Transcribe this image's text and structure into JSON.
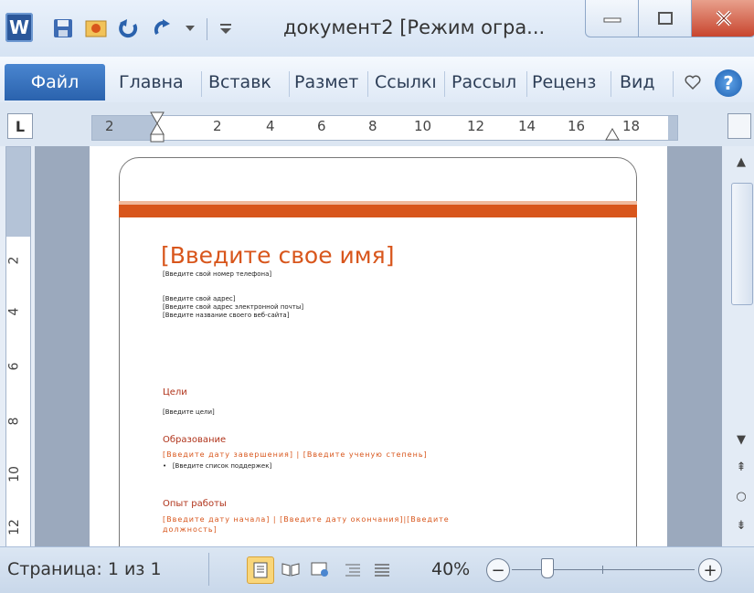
{
  "titlebar": {
    "app_icon_letter": "W",
    "title": "документ2 [Режим огра...",
    "quick_access": [
      "save-icon",
      "new-icon",
      "undo-icon",
      "redo-icon",
      "customize-icon"
    ]
  },
  "ribbon": {
    "file_tab": "Файл",
    "tabs": [
      "Главна",
      "Вставк",
      "Размет",
      "Ссылкı",
      "Рассыл",
      "Реценз",
      "Вид"
    ]
  },
  "ruler": {
    "tab_selector": "L",
    "h_numbers": [
      "2",
      "2",
      "4",
      "6",
      "8",
      "10",
      "12",
      "14",
      "16",
      "18"
    ],
    "v_numbers": [
      "2",
      "4",
      "6",
      "8",
      "10",
      "12"
    ]
  },
  "document": {
    "name": "[Введите свое имя]",
    "phone": "[Введите свой номер телефона]",
    "address": "[Введите свой адрес]",
    "email": "[Введите свой адрес электронной почты]",
    "website": "[Введите название своего веб-сайта]",
    "goals_heading": "Цели",
    "goals": "[Введите цели]",
    "education_heading": "Образование",
    "education_line": "[Введите дату завершения] | [Введите ученую степень]",
    "achievements": "[Введите список поддержек]",
    "experience_heading": "Опыт работы",
    "experience_line1": "[Введите дату начала] | [Введите дату окончания]|[Введите",
    "experience_line2": "должность]"
  },
  "statusbar": {
    "page": "Страница: 1 из 1",
    "zoom": "40%",
    "zoom_minus": "−",
    "zoom_plus": "+"
  },
  "colors": {
    "accent_orange": "#d8561c",
    "file_tab_blue": "#2a62ad"
  }
}
